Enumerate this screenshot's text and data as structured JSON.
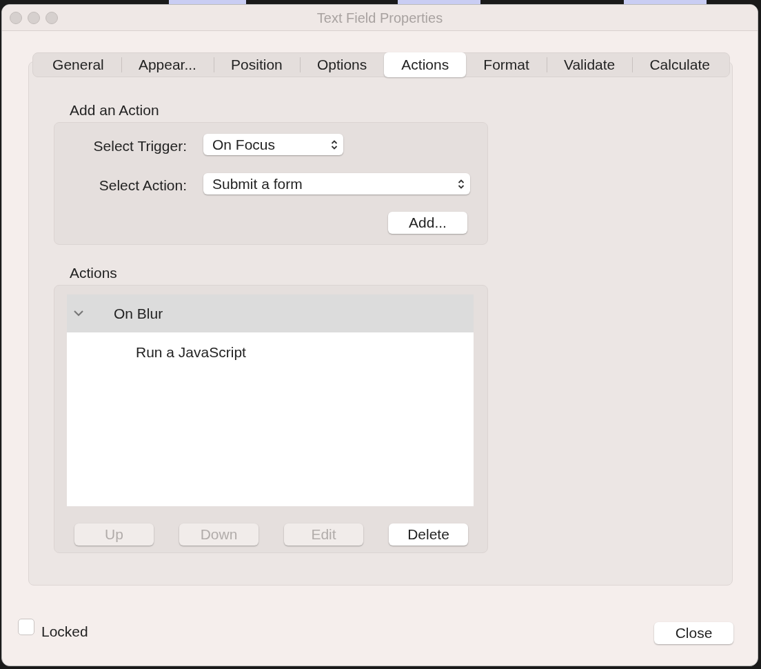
{
  "window": {
    "title": "Text Field Properties"
  },
  "tabs": [
    {
      "label": "General",
      "selected": false
    },
    {
      "label": "Appear...",
      "selected": false
    },
    {
      "label": "Position",
      "selected": false
    },
    {
      "label": "Options",
      "selected": false
    },
    {
      "label": "Actions",
      "selected": true
    },
    {
      "label": "Format",
      "selected": false
    },
    {
      "label": "Validate",
      "selected": false
    },
    {
      "label": "Calculate",
      "selected": false
    }
  ],
  "add_action": {
    "heading": "Add an Action",
    "trigger": {
      "label": "Select Trigger:",
      "value": "On Focus"
    },
    "action": {
      "label": "Select Action:",
      "value": "Submit a form"
    },
    "add_button": "Add..."
  },
  "actions": {
    "heading": "Actions",
    "tree": [
      {
        "label": "On Blur",
        "expanded": true,
        "selected": true,
        "children": [
          {
            "label": "Run a JavaScript"
          }
        ]
      }
    ],
    "buttons": [
      {
        "label": "Up",
        "disabled": true
      },
      {
        "label": "Down",
        "disabled": true
      },
      {
        "label": "Edit",
        "disabled": true
      },
      {
        "label": "Delete",
        "disabled": false
      }
    ]
  },
  "locked": {
    "label": "Locked",
    "checked": false
  },
  "close_button": "Close"
}
